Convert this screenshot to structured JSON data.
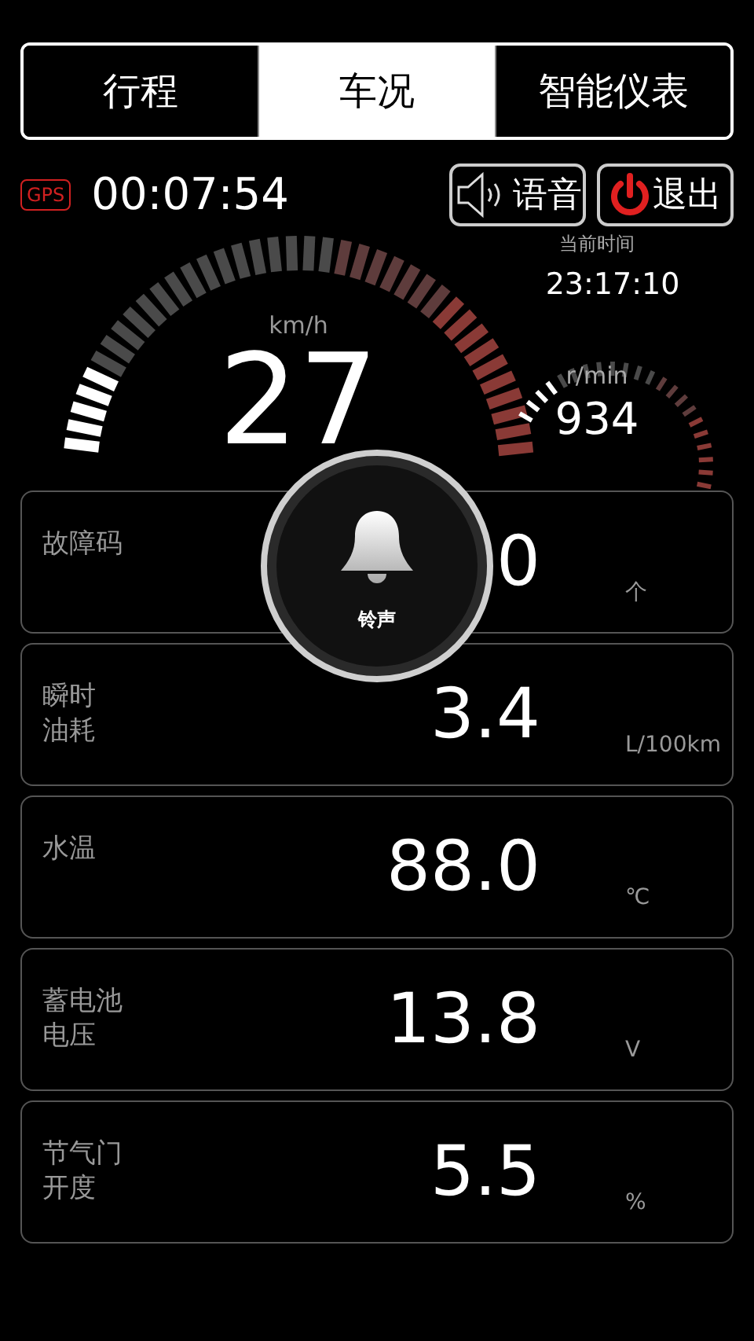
{
  "tabs": [
    {
      "label": "行程",
      "selected": false
    },
    {
      "label": "车况",
      "selected": true
    },
    {
      "label": "智能仪表",
      "selected": false
    }
  ],
  "header": {
    "gps_badge": "GPS",
    "elapsed": "00:07:54",
    "buttons": [
      {
        "kind": "voice",
        "label": "语音"
      },
      {
        "kind": "exit",
        "label": "退出"
      }
    ]
  },
  "clock": {
    "label": "当前时间",
    "time": "23:17:10"
  },
  "speed_gauge": {
    "unit": "km/h",
    "value": "27",
    "level": 0.12
  },
  "rpm_gauge": {
    "unit": "r/min",
    "value": "934",
    "level": 0.2
  },
  "readings": [
    {
      "label_lines": [
        "故障码"
      ],
      "value": "0",
      "unit": "个"
    },
    {
      "label_lines": [
        "瞬时",
        "油耗"
      ],
      "value": "3.4",
      "unit": "L/100km"
    },
    {
      "label_lines": [
        "水温"
      ],
      "value": "88.0",
      "unit": "℃"
    },
    {
      "label_lines": [
        "蓄电池",
        "电压"
      ],
      "value": "13.8",
      "unit": "V"
    },
    {
      "label_lines": [
        "节气门",
        "开度"
      ],
      "value": "5.5",
      "unit": "%"
    }
  ],
  "floating_button": {
    "label": "铃声"
  }
}
